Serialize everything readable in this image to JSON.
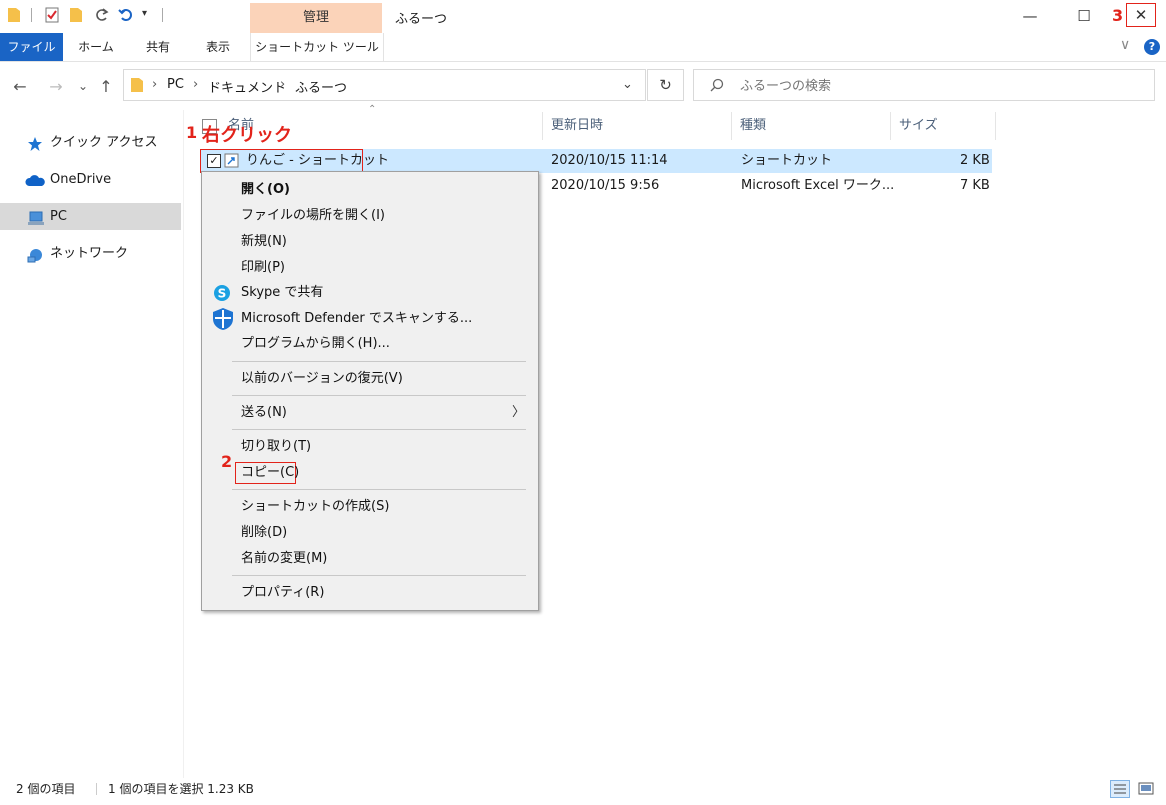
{
  "window": {
    "title": "ふるーつ",
    "contextual_tab_group": "管理",
    "minimize_glyph": "—",
    "maximize_glyph": "☐",
    "close_glyph": "✕"
  },
  "ribbon": {
    "tabs": [
      "ファイル",
      "ホーム",
      "共有",
      "表示",
      "ショートカット ツール"
    ],
    "collapse_glyph": "∨",
    "help_glyph": "?"
  },
  "navigation": {
    "back": "←",
    "forward": "→",
    "recent": "⌄",
    "up": "↑",
    "breadcrumb": [
      "PC",
      "ドキュメント",
      "ふるーつ"
    ],
    "breadcrumb_sep": "›",
    "dropdown": "⌄",
    "refresh": "↻",
    "search_placeholder": "ふるーつの検索"
  },
  "sidebar": {
    "items": [
      {
        "label": "クイック アクセス",
        "icon": "star-icon"
      },
      {
        "label": "OneDrive",
        "icon": "cloud-icon"
      },
      {
        "label": "PC",
        "icon": "computer-icon"
      },
      {
        "label": "ネットワーク",
        "icon": "network-icon"
      }
    ]
  },
  "columns": [
    "名前",
    "更新日時",
    "種類",
    "サイズ"
  ],
  "files": [
    {
      "name": "りんご - ショートカット",
      "modified": "2020/10/15 11:14",
      "type": "ショートカット",
      "size": "2 KB",
      "selected": true
    },
    {
      "name": "",
      "modified": "2020/10/15 9:56",
      "type": "Microsoft Excel ワーク...",
      "size": "7 KB",
      "selected": false
    }
  ],
  "context_menu": {
    "items": [
      {
        "label": "開く(O)",
        "bold": true
      },
      {
        "label": "ファイルの場所を開く(I)"
      },
      {
        "label": "新規(N)"
      },
      {
        "label": "印刷(P)"
      },
      {
        "label": "Skype で共有",
        "icon": "skype-icon"
      },
      {
        "label": "Microsoft Defender でスキャンする...",
        "icon": "defender-icon"
      },
      {
        "label": "プログラムから開く(H)..."
      },
      {
        "label": "以前のバージョンの復元(V)"
      },
      {
        "label": "送る(N)",
        "submenu": true
      },
      {
        "label": "切り取り(T)"
      },
      {
        "label": "コピー(C)"
      },
      {
        "label": "ショートカットの作成(S)"
      },
      {
        "label": "削除(D)"
      },
      {
        "label": "名前の変更(M)"
      },
      {
        "label": "プロパティ(R)"
      }
    ],
    "submenu_arrow": "〉"
  },
  "annotations": {
    "step1_num": "1",
    "step1_text": "右クリック",
    "step2_num": "2",
    "step3_num": "3"
  },
  "status": {
    "item_count": "2 個の項目",
    "selection": "1 個の項目を選択  1.23 KB"
  },
  "colors": {
    "accent": "#1a64c5",
    "manage_tab": "#fbd3b9",
    "selection": "#cce8ff",
    "annotation": "#e2231a"
  }
}
